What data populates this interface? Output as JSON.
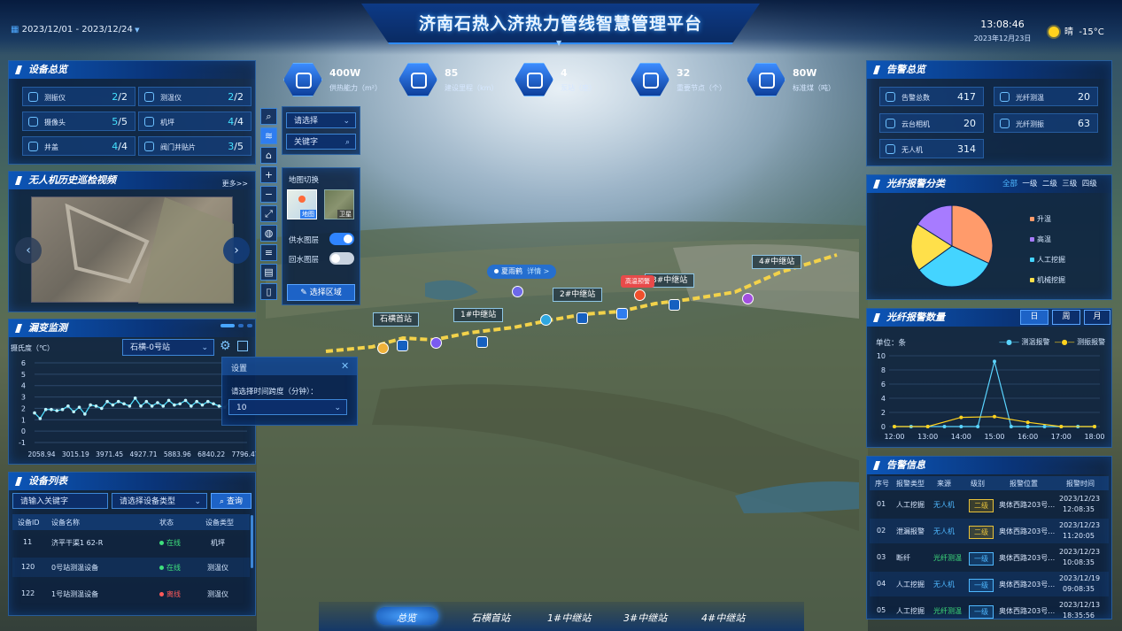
{
  "header": {
    "title": "济南石热入济热力管线智慧管理平台",
    "date_range": "2023/12/01 - 2023/12/24",
    "time": "13:08:46",
    "date": "2023年12月23日",
    "weather": "晴",
    "temperature": "-15°C"
  },
  "metrics": [
    {
      "value": "400W",
      "label": "供热能力（m²）",
      "icon": "heating-icon"
    },
    {
      "value": "85",
      "label": "建设里程（km）",
      "icon": "route-icon"
    },
    {
      "value": "4",
      "label": "泵站（座）",
      "icon": "pump-icon"
    },
    {
      "value": "32",
      "label": "重要节点（个）",
      "icon": "node-icon"
    },
    {
      "value": "80W",
      "label": "标准煤（吨）",
      "icon": "coal-icon"
    }
  ],
  "device_overview": {
    "title": "设备总览",
    "items": [
      {
        "name": "测振仪",
        "online": "2",
        "total": "/2"
      },
      {
        "name": "测温仪",
        "online": "2",
        "total": "/2"
      },
      {
        "name": "摄像头",
        "online": "5",
        "total": "/5"
      },
      {
        "name": "机坪",
        "online": "4",
        "total": "/4"
      },
      {
        "name": "井盖",
        "online": "4",
        "total": "/4"
      },
      {
        "name": "阀门井贴片",
        "online": "3",
        "total": "/5"
      }
    ]
  },
  "drone_video": {
    "title": "无人机历史巡检视频",
    "more": "更多>>"
  },
  "leak": {
    "title": "漏变监测",
    "ylabel": "摄氏度（℃）",
    "station": "石横-0号站"
  },
  "settings_popup": {
    "title": "设置",
    "label": "请选择时间跨度（分钟）：",
    "value": "10"
  },
  "device_list": {
    "title": "设备列表",
    "keyword_placeholder": "请输入关键字",
    "type_placeholder": "请选择设备类型",
    "query": "查询",
    "headers": [
      "设备ID",
      "设备名称",
      "状态",
      "设备类型"
    ],
    "rows": [
      {
        "id": "11",
        "name": "济平干渠1 62-R",
        "status": "在线",
        "type": "机坪"
      },
      {
        "id": "120",
        "name": "0号站测温设备",
        "status": "在线",
        "type": "测温仪"
      },
      {
        "id": "122",
        "name": "1号站测温设备",
        "status": "离线",
        "type": "测温仪"
      }
    ]
  },
  "map_tools": {
    "select_placeholder": "请选择",
    "keyword_placeholder": "关键字",
    "switch_title": "地图切换",
    "map_label": "地图",
    "satellite_label": "卫星",
    "supply_layer": "供水图层",
    "return_layer": "回水图层",
    "select_area": "选择区域"
  },
  "map": {
    "labels": [
      "石横首站",
      "1#中继站",
      "2#中继站",
      "3#中继站",
      "4#中继站"
    ],
    "popup": "夏雨鹤",
    "popup_detail": "详情 >",
    "alarm": "高温预警"
  },
  "alarm_overview": {
    "title": "告警总览",
    "items": [
      {
        "name": "告警总数",
        "value": "417"
      },
      {
        "name": "光纤测温",
        "value": "20"
      },
      {
        "name": "云台相机",
        "value": "20"
      },
      {
        "name": "光纤测振",
        "value": "63"
      },
      {
        "name": "无人机",
        "value": "314"
      }
    ]
  },
  "fiber_category": {
    "title": "光纤报警分类",
    "tabs": [
      "全部",
      "一级",
      "二级",
      "三级",
      "四级"
    ],
    "legend": [
      "升温",
      "高温",
      "人工挖掘",
      "机械挖掘"
    ]
  },
  "fiber_count": {
    "title": "光纤报警数量",
    "tabs": [
      "日",
      "周",
      "月"
    ],
    "unit": "单位：条",
    "legend": [
      "测温报警",
      "测振报警"
    ]
  },
  "alarm_info": {
    "title": "告警信息",
    "headers": [
      "序号",
      "报警类型",
      "来源",
      "级别",
      "报警位置",
      "报警时间"
    ],
    "rows": [
      {
        "no": "01",
        "type": "人工挖掘",
        "source": "无人机",
        "level": "二级",
        "loc": "奥体西路203号…",
        "date": "2023/12/23",
        "time": "12:08:35"
      },
      {
        "no": "02",
        "type": "泄漏报警",
        "source": "无人机",
        "level": "二级",
        "loc": "奥体西路203号…",
        "date": "2023/12/23",
        "time": "11:20:05"
      },
      {
        "no": "03",
        "type": "断纤",
        "source": "光纤测温",
        "level": "一级",
        "loc": "奥体西路203号…",
        "date": "2023/12/23",
        "time": "10:08:35"
      },
      {
        "no": "04",
        "type": "人工挖掘",
        "source": "无人机",
        "level": "一级",
        "loc": "奥体西路203号…",
        "date": "2023/12/19",
        "time": "09:08:35"
      },
      {
        "no": "05",
        "type": "人工挖掘",
        "source": "光纤测温",
        "level": "一级",
        "loc": "奥体西路203号…",
        "date": "2023/12/13",
        "time": "18:35:56"
      }
    ]
  },
  "bottom_nav": [
    "总览",
    "石横首站",
    "1#中继站",
    "3#中继站",
    "4#中继站"
  ],
  "chart_data": [
    {
      "type": "line",
      "title": "",
      "ylabel": "摄氏度（℃）",
      "x_tick_labels": [
        "2058.94",
        "3015.19",
        "3971.45",
        "4927.71",
        "5883.96",
        "6840.22",
        "7796.47"
      ],
      "ylim": [
        -1,
        6
      ],
      "y_ticks": [
        -1,
        0,
        1,
        2,
        3,
        4,
        5,
        6
      ],
      "series": [
        {
          "values": [
            1.6,
            1.1,
            1.9,
            1.9,
            1.8,
            1.9,
            2.2,
            1.7,
            2.1,
            1.5,
            2.3,
            2.2,
            2.0,
            2.6,
            2.3,
            2.6,
            2.4,
            2.2,
            2.9,
            2.2,
            2.6,
            2.2,
            2.5,
            2.2,
            2.7,
            2.3,
            2.4,
            2.7,
            2.2,
            2.6,
            2.3,
            2.6,
            2.4,
            2.2,
            2.1,
            2.6,
            2.2,
            2.4,
            2.1
          ]
        }
      ],
      "color": "#4fe0ff"
    },
    {
      "type": "pie",
      "title": "",
      "slices": [
        {
          "label": "升温",
          "value": 32,
          "color": "#ff9b6b"
        },
        {
          "label": "人工挖掘",
          "value": 33,
          "color": "#44d4ff"
        },
        {
          "label": "机械挖掘",
          "value": 19,
          "color": "#ffe04a"
        },
        {
          "label": "高温",
          "value": 16,
          "color": "#a77bff"
        }
      ]
    },
    {
      "type": "line",
      "title": "",
      "ylabel": "单位：条",
      "categories": [
        "12:00",
        "13:00",
        "14:00",
        "15:00",
        "16:00",
        "17:00",
        "18:00"
      ],
      "ylim": [
        0,
        10
      ],
      "y_ticks": [
        0,
        2,
        4,
        6,
        8,
        10
      ],
      "series": [
        {
          "name": "测温报警",
          "color": "#5ad4ff",
          "x": [
            0,
            0.5,
            1,
            1.5,
            2,
            2.5,
            3,
            3.5,
            4,
            4.5,
            5,
            5.5,
            6
          ],
          "values": [
            0,
            0,
            0,
            0,
            0,
            0,
            9.2,
            0,
            0,
            0,
            0,
            0,
            0
          ]
        },
        {
          "name": "测振报警",
          "color": "#ffd21e",
          "x": [
            0,
            1,
            2,
            3,
            4,
            5,
            6
          ],
          "values": [
            0,
            0,
            1.3,
            1.4,
            0.6,
            0,
            0
          ]
        }
      ]
    }
  ]
}
